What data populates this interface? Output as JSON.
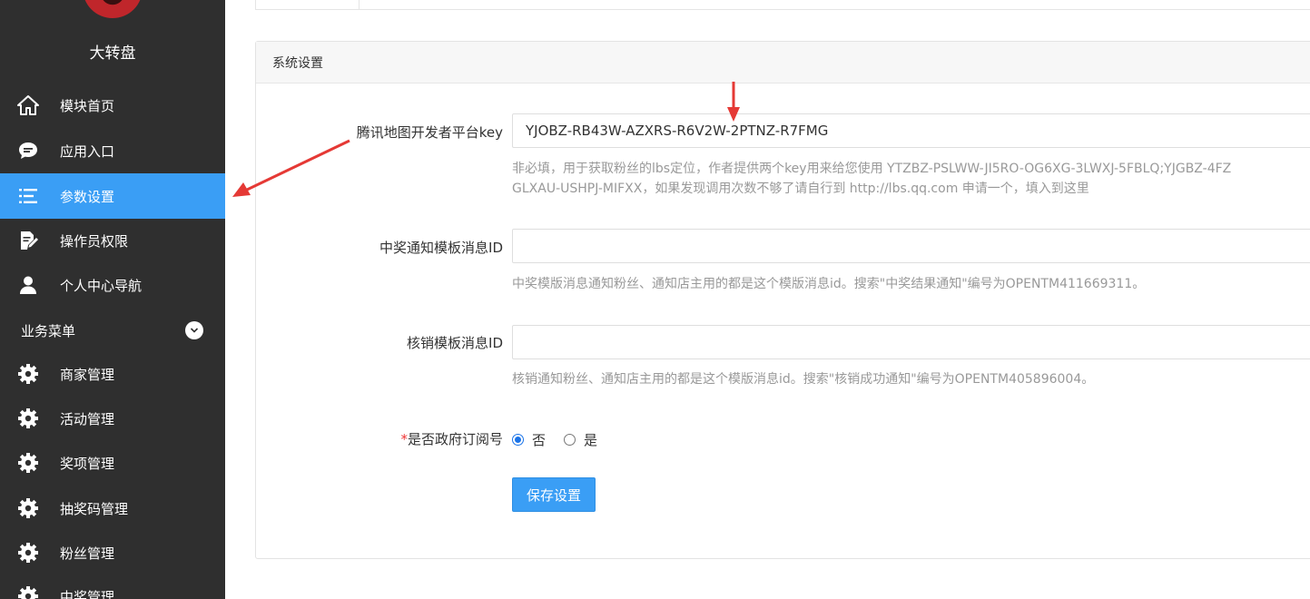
{
  "sidebar": {
    "app_title": "大转盘",
    "items": [
      {
        "label": "模块首页",
        "icon": "home-icon"
      },
      {
        "label": "应用入口",
        "icon": "chat-icon"
      },
      {
        "label": "参数设置",
        "icon": "list-icon",
        "active": true
      },
      {
        "label": "操作员权限",
        "icon": "edit-icon"
      },
      {
        "label": "个人中心导航",
        "icon": "user-icon"
      }
    ],
    "group": {
      "label": "业务菜单",
      "icon": "chevron-down-icon"
    },
    "group_items": [
      {
        "label": "商家管理",
        "icon": "gear-icon"
      },
      {
        "label": "活动管理",
        "icon": "gear-icon"
      },
      {
        "label": "奖项管理",
        "icon": "gear-icon"
      },
      {
        "label": "抽奖码管理",
        "icon": "gear-icon"
      },
      {
        "label": "粉丝管理",
        "icon": "gear-icon"
      },
      {
        "label": "中奖管理",
        "icon": "gear-icon"
      }
    ]
  },
  "panel": {
    "title": "系统设置",
    "fields": {
      "map_key": {
        "label": "腾讯地图开发者平台key",
        "value": "YJOBZ-RB43W-AZXRS-R6V2W-2PTNZ-R7FMG",
        "help_line1": "非必填，用于获取粉丝的lbs定位，作者提供两个key用来给您使用 YTZBZ-PSLWW-JI5RO-OG6XG-3LWXJ-5FBLQ;YJGBZ-4FZ",
        "help_line2": "GLXAU-USHPJ-MIFXX，如果发现调用次数不够了请自行到 http://lbs.qq.com 申请一个，填入到这里"
      },
      "win_template": {
        "label": "中奖通知模板消息ID",
        "value": "",
        "help": "中奖模版消息通知粉丝、通知店主用的都是这个模版消息id。搜索\"中奖结果通知\"编号为OPENTM411669311。"
      },
      "verify_template": {
        "label": "核销模板消息ID",
        "value": "",
        "help": "核销通知粉丝、通知店主用的都是这个模版消息id。搜索\"核销成功通知\"编号为OPENTM405896004。"
      },
      "gov_account": {
        "required_mark": "*",
        "label": "是否政府订阅号",
        "options": [
          {
            "label": "否",
            "checked": true
          },
          {
            "label": "是",
            "checked": false
          }
        ]
      }
    },
    "save_label": "保存设置"
  },
  "colors": {
    "sidebar_bg": "#2f2f2f",
    "accent": "#3a9ef5",
    "annotation": "#e53935"
  }
}
